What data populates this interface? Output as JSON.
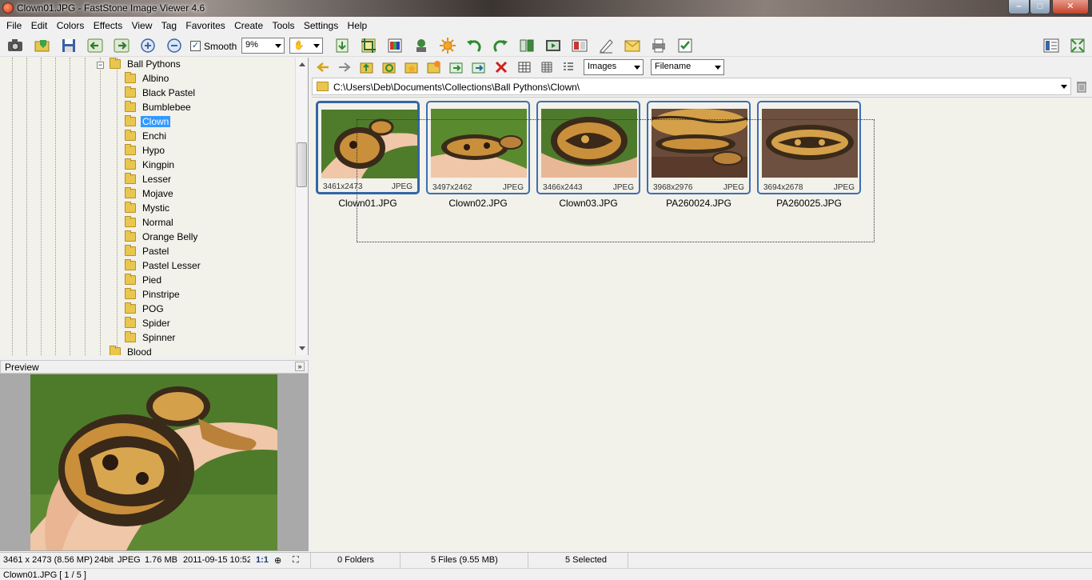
{
  "window": {
    "title": "Clown01.JPG  -  FastStone Image Viewer 4.6",
    "controls": [
      "minimize",
      "maximize",
      "close"
    ]
  },
  "menu": [
    "File",
    "Edit",
    "Colors",
    "Effects",
    "View",
    "Tag",
    "Favorites",
    "Create",
    "Tools",
    "Settings",
    "Help"
  ],
  "toolbar": {
    "smooth_label": "Smooth",
    "smooth_checked": true,
    "zoom_value": "9%",
    "icons": [
      "camera-icon",
      "open-folder-icon",
      "save-icon",
      "back-icon",
      "forward-icon",
      "zoom-in-icon",
      "zoom-out-icon"
    ],
    "right_icons": [
      "import-icon",
      "crop-icon",
      "color-icon",
      "stamp-icon",
      "sun-icon",
      "rotate-left-icon",
      "rotate-right-icon",
      "flip-icon",
      "slideshow-icon",
      "compare-icon",
      "draw-icon",
      "email-icon",
      "print-icon",
      "checklist-icon"
    ]
  },
  "tree": {
    "parent": "Ball Pythons",
    "items": [
      "Albino",
      "Black Pastel",
      "Bumblebee",
      "Clown",
      "Enchi",
      "Hypo",
      "Kingpin",
      "Lesser",
      "Mojave",
      "Mystic",
      "Normal",
      "Orange Belly",
      "Pastel",
      "Pastel Lesser",
      "Pied",
      "Pinstripe",
      "POG",
      "Spider",
      "Spinner"
    ],
    "selected": "Clown",
    "next_sibling": "Blood"
  },
  "preview": {
    "label": "Preview"
  },
  "browser": {
    "filter": "Images",
    "sort": "Filename",
    "path": "C:\\Users\\Deb\\Documents\\Collections\\Ball Pythons\\Clown\\",
    "thumbnails": [
      {
        "name": "Clown01.JPG",
        "dims": "3461x2473",
        "format": "JPEG"
      },
      {
        "name": "Clown02.JPG",
        "dims": "3497x2462",
        "format": "JPEG"
      },
      {
        "name": "Clown03.JPG",
        "dims": "3466x2443",
        "format": "JPEG"
      },
      {
        "name": "PA260024.JPG",
        "dims": "3968x2976",
        "format": "JPEG"
      },
      {
        "name": "PA260025.JPG",
        "dims": "3694x2678",
        "format": "JPEG"
      }
    ]
  },
  "status": {
    "image_info": "3461 x 2473 (8.56 MP)",
    "bit_depth": "24bit",
    "format": "JPEG",
    "size": "1.76 MB",
    "date": "2011-09-15 10:52",
    "ratio": "1:1",
    "folders": "0 Folders",
    "files": "5 Files (9.55 MB)",
    "selected": "5 Selected",
    "current": "Clown01.JPG [ 1 / 5 ]"
  },
  "colors": {
    "selection": "#3399ff",
    "thumb_border": "#3d6eb4",
    "panel_bg": "#f2f1ea"
  }
}
